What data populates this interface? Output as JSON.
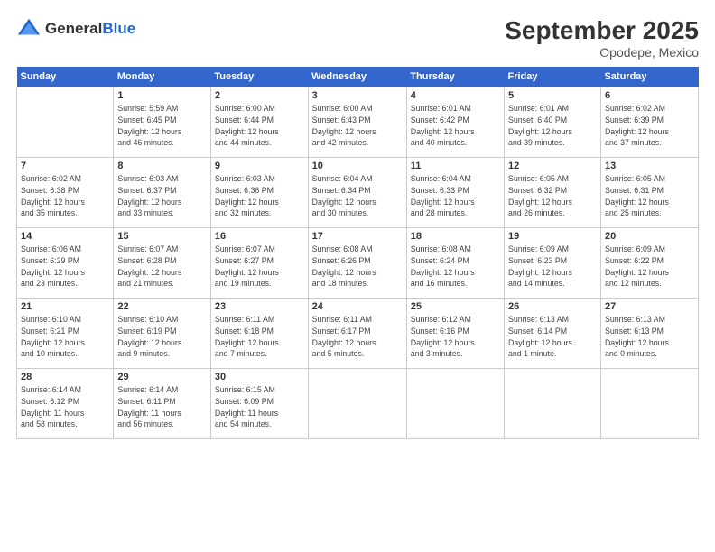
{
  "header": {
    "logo_general": "General",
    "logo_blue": "Blue",
    "month_title": "September 2025",
    "location": "Opodepe, Mexico"
  },
  "weekdays": [
    "Sunday",
    "Monday",
    "Tuesday",
    "Wednesday",
    "Thursday",
    "Friday",
    "Saturday"
  ],
  "weeks": [
    [
      {
        "day": "",
        "info": ""
      },
      {
        "day": "1",
        "info": "Sunrise: 5:59 AM\nSunset: 6:45 PM\nDaylight: 12 hours\nand 46 minutes."
      },
      {
        "day": "2",
        "info": "Sunrise: 6:00 AM\nSunset: 6:44 PM\nDaylight: 12 hours\nand 44 minutes."
      },
      {
        "day": "3",
        "info": "Sunrise: 6:00 AM\nSunset: 6:43 PM\nDaylight: 12 hours\nand 42 minutes."
      },
      {
        "day": "4",
        "info": "Sunrise: 6:01 AM\nSunset: 6:42 PM\nDaylight: 12 hours\nand 40 minutes."
      },
      {
        "day": "5",
        "info": "Sunrise: 6:01 AM\nSunset: 6:40 PM\nDaylight: 12 hours\nand 39 minutes."
      },
      {
        "day": "6",
        "info": "Sunrise: 6:02 AM\nSunset: 6:39 PM\nDaylight: 12 hours\nand 37 minutes."
      }
    ],
    [
      {
        "day": "7",
        "info": "Sunrise: 6:02 AM\nSunset: 6:38 PM\nDaylight: 12 hours\nand 35 minutes."
      },
      {
        "day": "8",
        "info": "Sunrise: 6:03 AM\nSunset: 6:37 PM\nDaylight: 12 hours\nand 33 minutes."
      },
      {
        "day": "9",
        "info": "Sunrise: 6:03 AM\nSunset: 6:36 PM\nDaylight: 12 hours\nand 32 minutes."
      },
      {
        "day": "10",
        "info": "Sunrise: 6:04 AM\nSunset: 6:34 PM\nDaylight: 12 hours\nand 30 minutes."
      },
      {
        "day": "11",
        "info": "Sunrise: 6:04 AM\nSunset: 6:33 PM\nDaylight: 12 hours\nand 28 minutes."
      },
      {
        "day": "12",
        "info": "Sunrise: 6:05 AM\nSunset: 6:32 PM\nDaylight: 12 hours\nand 26 minutes."
      },
      {
        "day": "13",
        "info": "Sunrise: 6:05 AM\nSunset: 6:31 PM\nDaylight: 12 hours\nand 25 minutes."
      }
    ],
    [
      {
        "day": "14",
        "info": "Sunrise: 6:06 AM\nSunset: 6:29 PM\nDaylight: 12 hours\nand 23 minutes."
      },
      {
        "day": "15",
        "info": "Sunrise: 6:07 AM\nSunset: 6:28 PM\nDaylight: 12 hours\nand 21 minutes."
      },
      {
        "day": "16",
        "info": "Sunrise: 6:07 AM\nSunset: 6:27 PM\nDaylight: 12 hours\nand 19 minutes."
      },
      {
        "day": "17",
        "info": "Sunrise: 6:08 AM\nSunset: 6:26 PM\nDaylight: 12 hours\nand 18 minutes."
      },
      {
        "day": "18",
        "info": "Sunrise: 6:08 AM\nSunset: 6:24 PM\nDaylight: 12 hours\nand 16 minutes."
      },
      {
        "day": "19",
        "info": "Sunrise: 6:09 AM\nSunset: 6:23 PM\nDaylight: 12 hours\nand 14 minutes."
      },
      {
        "day": "20",
        "info": "Sunrise: 6:09 AM\nSunset: 6:22 PM\nDaylight: 12 hours\nand 12 minutes."
      }
    ],
    [
      {
        "day": "21",
        "info": "Sunrise: 6:10 AM\nSunset: 6:21 PM\nDaylight: 12 hours\nand 10 minutes."
      },
      {
        "day": "22",
        "info": "Sunrise: 6:10 AM\nSunset: 6:19 PM\nDaylight: 12 hours\nand 9 minutes."
      },
      {
        "day": "23",
        "info": "Sunrise: 6:11 AM\nSunset: 6:18 PM\nDaylight: 12 hours\nand 7 minutes."
      },
      {
        "day": "24",
        "info": "Sunrise: 6:11 AM\nSunset: 6:17 PM\nDaylight: 12 hours\nand 5 minutes."
      },
      {
        "day": "25",
        "info": "Sunrise: 6:12 AM\nSunset: 6:16 PM\nDaylight: 12 hours\nand 3 minutes."
      },
      {
        "day": "26",
        "info": "Sunrise: 6:13 AM\nSunset: 6:14 PM\nDaylight: 12 hours\nand 1 minute."
      },
      {
        "day": "27",
        "info": "Sunrise: 6:13 AM\nSunset: 6:13 PM\nDaylight: 12 hours\nand 0 minutes."
      }
    ],
    [
      {
        "day": "28",
        "info": "Sunrise: 6:14 AM\nSunset: 6:12 PM\nDaylight: 11 hours\nand 58 minutes."
      },
      {
        "day": "29",
        "info": "Sunrise: 6:14 AM\nSunset: 6:11 PM\nDaylight: 11 hours\nand 56 minutes."
      },
      {
        "day": "30",
        "info": "Sunrise: 6:15 AM\nSunset: 6:09 PM\nDaylight: 11 hours\nand 54 minutes."
      },
      {
        "day": "",
        "info": ""
      },
      {
        "day": "",
        "info": ""
      },
      {
        "day": "",
        "info": ""
      },
      {
        "day": "",
        "info": ""
      }
    ]
  ]
}
